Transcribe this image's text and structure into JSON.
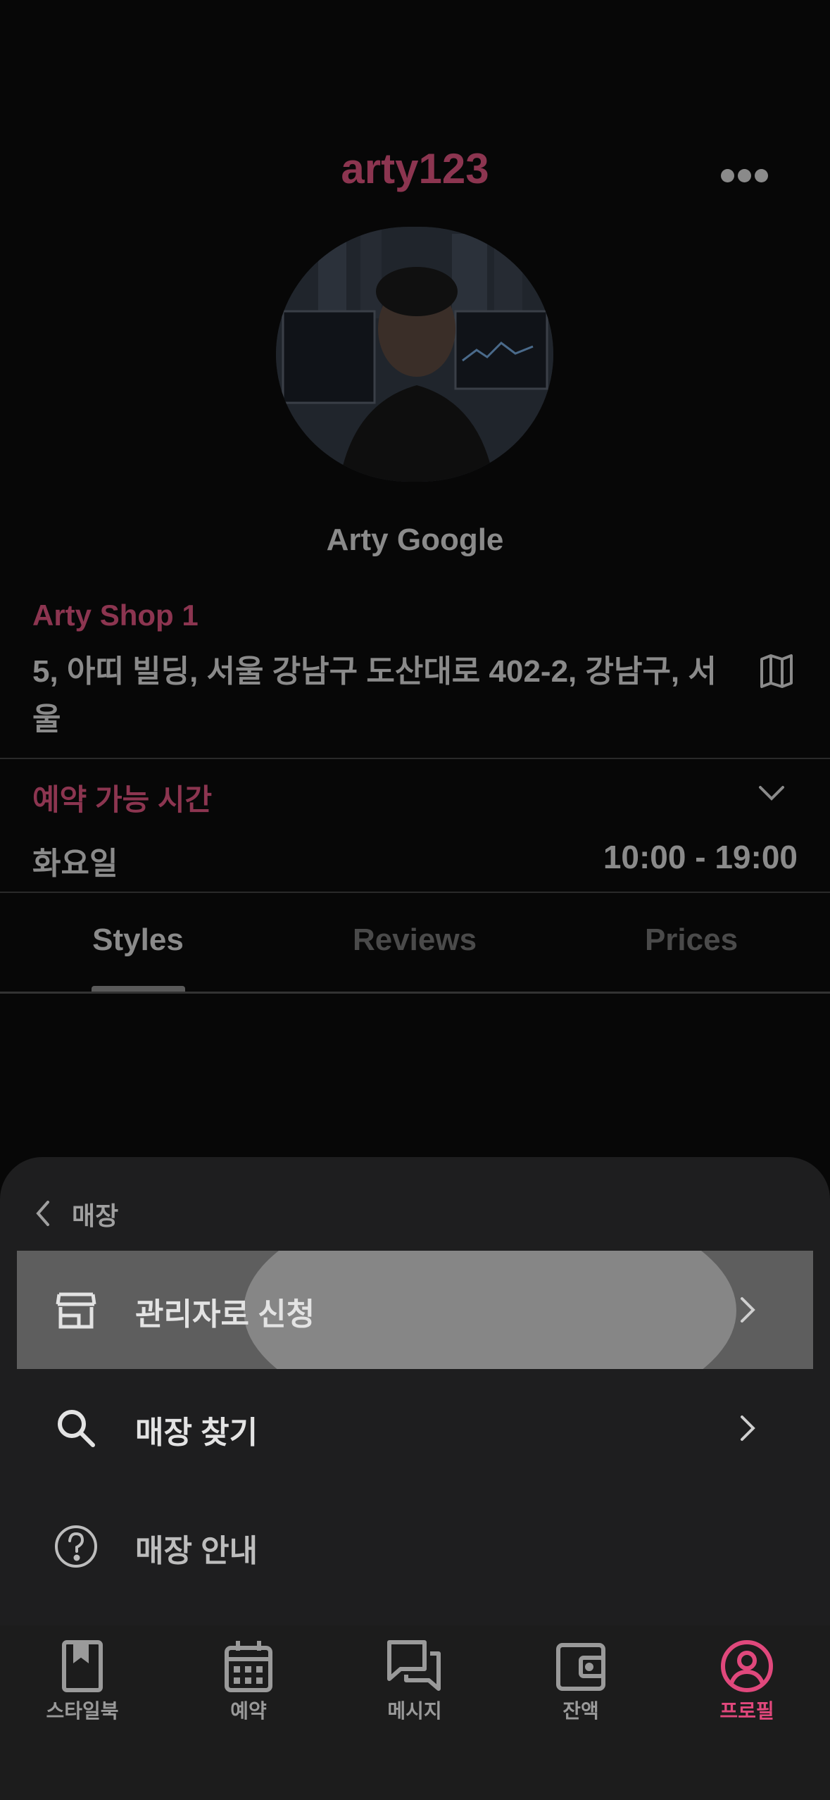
{
  "header": {
    "username": "arty123",
    "more_icon": "more-horizontal-icon"
  },
  "profile": {
    "display_name": "Arty Google",
    "shop_name": "Arty Shop 1",
    "address": "5, 아띠 빌딩, 서울 강남구 도산대로 402-2, 강남구, 서울"
  },
  "availability": {
    "title": "예약 가능 시간",
    "day": "화요일",
    "hours": "10:00 - 19:00"
  },
  "tabs": [
    {
      "label": "Styles",
      "active": true
    },
    {
      "label": "Reviews",
      "active": false
    },
    {
      "label": "Prices",
      "active": false
    }
  ],
  "sheet": {
    "title": "매장",
    "items": [
      {
        "label": "관리자로 신청",
        "icon": "store-icon",
        "chevron": true
      },
      {
        "label": "매장 찾기",
        "icon": "search-icon",
        "chevron": true
      },
      {
        "label": "매장 안내",
        "icon": "help-circle-icon",
        "chevron": false
      }
    ]
  },
  "nav": [
    {
      "label": "스타일북",
      "icon": "book-icon",
      "active": false
    },
    {
      "label": "예약",
      "icon": "calendar-icon",
      "active": false
    },
    {
      "label": "메시지",
      "icon": "chat-icon",
      "active": false
    },
    {
      "label": "잔액",
      "icon": "wallet-icon",
      "active": false
    },
    {
      "label": "프로필",
      "icon": "profile-icon",
      "active": true
    }
  ],
  "colors": {
    "accent": "#e0487c",
    "accent_dim": "#8c3550",
    "background": "#070707",
    "sheet": "#1e1e1f"
  }
}
